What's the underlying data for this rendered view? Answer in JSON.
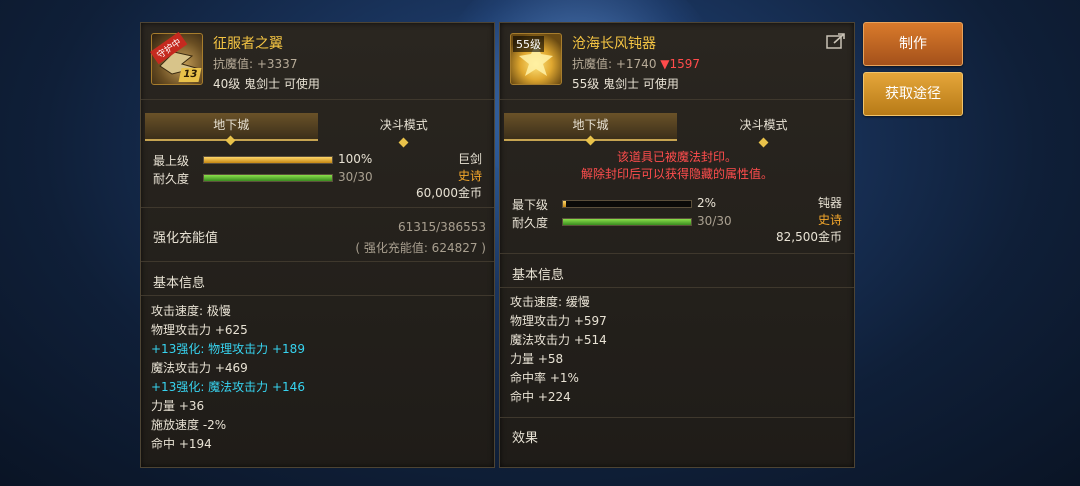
{
  "left_item": {
    "name": "征服者之翼",
    "magic_resist": "抗魔值: +3337",
    "requirement": "40级 鬼剑士 可使用",
    "icon_badge": "守护中",
    "icon_level": "13",
    "tabs": [
      "地下城",
      "决斗模式"
    ],
    "level_label": "最上级",
    "level_percent": 100,
    "level_text": "100%",
    "durability_label": "耐久度",
    "durability_fraction": 1.0,
    "durability_text": "30/30",
    "type": "巨剑",
    "rarity": "史诗",
    "price": "60,000金币",
    "charge_label": "强化充能值",
    "charge_value": "61315/386553",
    "charge_total": "( 强化充能值: 624827 )",
    "basic_info_title": "基本信息",
    "stats": [
      {
        "text": "攻击速度: 极慢",
        "highlight": false
      },
      {
        "text": "物理攻击力 +625",
        "highlight": false
      },
      {
        "text": "+13强化: 物理攻击力 +189",
        "highlight": true
      },
      {
        "text": "魔法攻击力 +469",
        "highlight": false
      },
      {
        "text": "+13强化: 魔法攻击力 +146",
        "highlight": true
      },
      {
        "text": "力量 +36",
        "highlight": false
      },
      {
        "text": "施放速度 -2%",
        "highlight": false
      },
      {
        "text": "命中 +194",
        "highlight": false
      }
    ]
  },
  "right_item": {
    "name": "沧海长风钝器",
    "magic_resist": "抗魔值: +1740",
    "magic_resist_diff": "▼1597",
    "requirement": "55级 鬼剑士 可使用",
    "icon_level": "55级",
    "tabs": [
      "地下城",
      "决斗模式"
    ],
    "seal_warning_1": "该道具已被魔法封印。",
    "seal_warning_2": "解除封印后可以获得隐藏的属性值。",
    "level_label": "最下级",
    "level_percent": 2,
    "level_text": "2%",
    "durability_label": "耐久度",
    "durability_fraction": 1.0,
    "durability_text": "30/30",
    "type": "钝器",
    "rarity": "史诗",
    "price": "82,500金币",
    "basic_info_title": "基本信息",
    "stats": [
      {
        "text": "攻击速度: 缓慢",
        "highlight": false
      },
      {
        "text": "物理攻击力 +597",
        "highlight": false
      },
      {
        "text": "魔法攻击力 +514",
        "highlight": false
      },
      {
        "text": "力量 +58",
        "highlight": false
      },
      {
        "text": "命中率 +1%",
        "highlight": false
      },
      {
        "text": "命中 +224",
        "highlight": false
      }
    ],
    "effects_title": "效果"
  },
  "buttons": {
    "make": "制作",
    "source": "获取途径"
  },
  "colors": {
    "item_name": "#f4c443",
    "epic": "#f4a72b",
    "enhance_cyan": "#37d4f0",
    "warning": "#ff4d4d",
    "make_button": "#c96a22",
    "source_button": "#d89428"
  }
}
